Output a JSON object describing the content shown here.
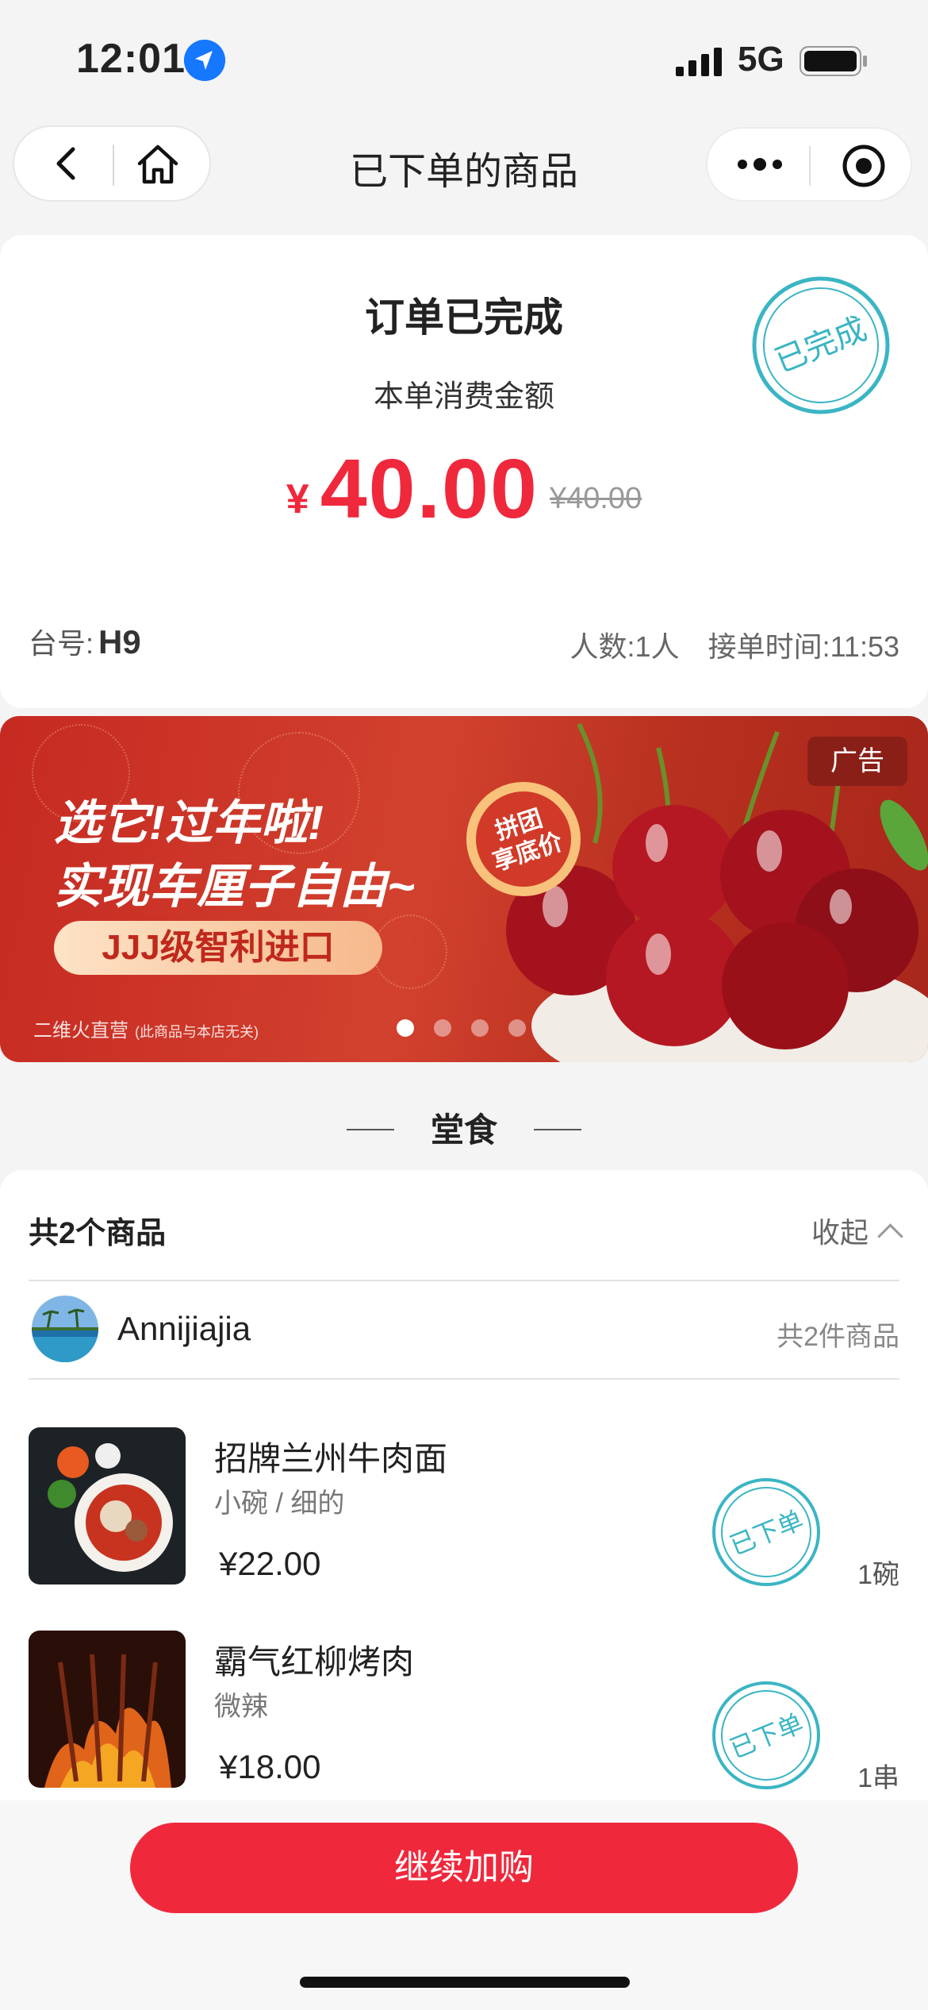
{
  "status_bar": {
    "time": "12:01",
    "network": "5G"
  },
  "nav": {
    "title": "已下单的商品"
  },
  "order": {
    "status": "订单已完成",
    "amount_label": "本单消费金额",
    "currency": "¥",
    "amount": "40.00",
    "original_amount": "¥40.00",
    "stamp": "已完成",
    "table_label": "台号:",
    "table_value": "H9",
    "people": "人数:1人",
    "order_time": "接单时间:11:53"
  },
  "banner": {
    "ad_tag": "广告",
    "line1": "选它!过年啦!",
    "line2": "实现车厘子自由~",
    "pill": "JJJ级智利进口",
    "badge_line1": "拼团",
    "badge_line2": "享底价",
    "source": "二维火直营",
    "source_note": "(此商品与本店无关)",
    "active_dot": 0,
    "dot_count": 4
  },
  "section": {
    "title": "堂食"
  },
  "goods": {
    "count_label": "共2个商品",
    "collapse_label": "收起",
    "user": {
      "name": "Annijiajia",
      "count": "共2件商品"
    },
    "items": [
      {
        "name": "招牌兰州牛肉面",
        "spec": "小碗 / 细的",
        "price": "¥22.00",
        "stamp": "已下单",
        "qty": "1碗"
      },
      {
        "name": "霸气红柳烤肉",
        "spec": "微辣",
        "price": "¥18.00",
        "stamp": "已下单",
        "qty": "1串"
      }
    ]
  },
  "cta": {
    "label": "继续加购"
  },
  "colors": {
    "accent": "#f0283c",
    "stamp": "#3ab5c4"
  }
}
